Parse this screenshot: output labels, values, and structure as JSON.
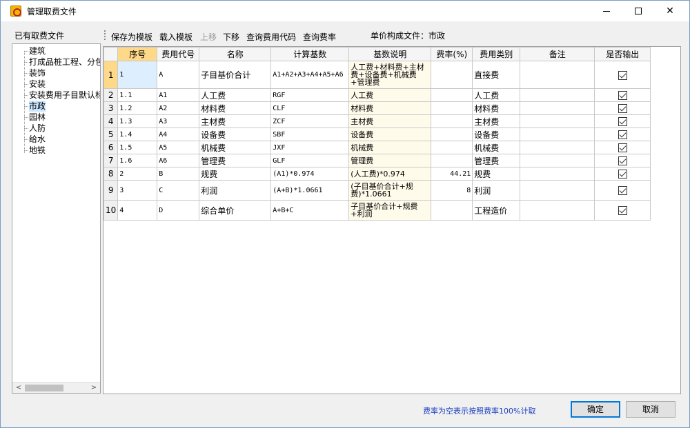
{
  "window": {
    "title": "管理取费文件"
  },
  "left_panel": {
    "label": "已有取费文件",
    "items": [
      "建筑",
      "打成品桩工程、分包",
      "装饰",
      "安装",
      "安装费用子目默认标",
      "市政",
      "园林",
      "人防",
      "给水",
      "地铁"
    ],
    "selected": "市政"
  },
  "toolbar": {
    "items": [
      {
        "label": "保存为模板",
        "enabled": true
      },
      {
        "label": "载入模板",
        "enabled": true
      },
      {
        "label": "上移",
        "enabled": false
      },
      {
        "label": "下移",
        "enabled": true
      },
      {
        "label": "查询费用代码",
        "enabled": true
      },
      {
        "label": "查询费率",
        "enabled": true
      }
    ],
    "file_label": "单价构成文件：市政"
  },
  "table": {
    "columns": [
      "",
      "序号",
      "费用代号",
      "名称",
      "计算基数",
      "基数说明",
      "费率(%)",
      "费用类别",
      "备注",
      "是否输出"
    ],
    "rows": [
      {
        "n": "1",
        "seq": "1",
        "code": "A",
        "name": "子目基价合计",
        "base": "A1+A2+A3+A4+A5+A6",
        "desc": "人工费+材料费+主材费+设备费+机械费+管理费",
        "rate": "",
        "cat": "直接费",
        "note": "",
        "output": true
      },
      {
        "n": "2",
        "seq": "1.1",
        "code": "A1",
        "name": "人工费",
        "base": "RGF",
        "desc": "人工费",
        "rate": "",
        "cat": "人工费",
        "note": "",
        "output": true
      },
      {
        "n": "3",
        "seq": "1.2",
        "code": "A2",
        "name": "材料费",
        "base": "CLF",
        "desc": "材料费",
        "rate": "",
        "cat": "材料费",
        "note": "",
        "output": true
      },
      {
        "n": "4",
        "seq": "1.3",
        "code": "A3",
        "name": "主材费",
        "base": "ZCF",
        "desc": "主材费",
        "rate": "",
        "cat": "主材费",
        "note": "",
        "output": true
      },
      {
        "n": "5",
        "seq": "1.4",
        "code": "A4",
        "name": "设备费",
        "base": "SBF",
        "desc": "设备费",
        "rate": "",
        "cat": "设备费",
        "note": "",
        "output": true
      },
      {
        "n": "6",
        "seq": "1.5",
        "code": "A5",
        "name": "机械费",
        "base": "JXF",
        "desc": "机械费",
        "rate": "",
        "cat": "机械费",
        "note": "",
        "output": true
      },
      {
        "n": "7",
        "seq": "1.6",
        "code": "A6",
        "name": "管理费",
        "base": "GLF",
        "desc": "管理费",
        "rate": "",
        "cat": "管理费",
        "note": "",
        "output": true
      },
      {
        "n": "8",
        "seq": "2",
        "code": "B",
        "name": "规费",
        "base": "(A1)*0.974",
        "desc": "(人工费)*0.974",
        "rate": "44.21",
        "cat": "规费",
        "note": "",
        "output": true
      },
      {
        "n": "9",
        "seq": "3",
        "code": "C",
        "name": "利润",
        "base": "(A+B)*1.0661",
        "desc": "(子目基价合计+规费)*1.0661",
        "rate": "8",
        "cat": "利润",
        "note": "",
        "output": true
      },
      {
        "n": "10",
        "seq": "4",
        "code": "D",
        "name": "综合单价",
        "base": "A+B+C",
        "desc": "子目基价合计+规费+利润",
        "rate": "",
        "cat": "工程造价",
        "note": "",
        "output": true
      }
    ]
  },
  "footer": {
    "note": "费率为空表示按照费率100%计取",
    "ok_label": "确定",
    "cancel_label": "取消"
  }
}
